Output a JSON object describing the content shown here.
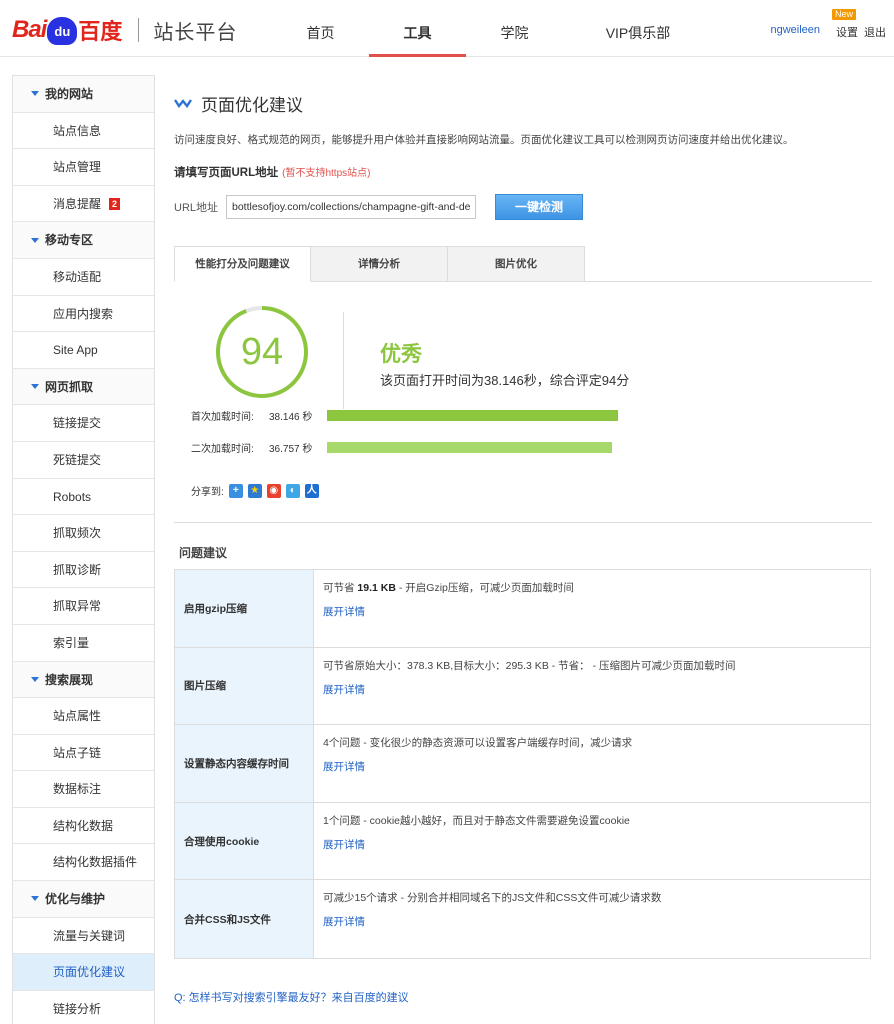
{
  "header": {
    "logo_bai": "Bai",
    "logo_paw": "du",
    "logo_du": "百度",
    "subtitle": "站长平台",
    "nav": [
      "首页",
      "工具",
      "学院",
      "VIP俱乐部"
    ],
    "active_nav": "工具",
    "username": "ngweileen",
    "settings": "设置",
    "new_badge": "New",
    "logout": "退出"
  },
  "sidebar": [
    {
      "type": "group",
      "label": "我的网站"
    },
    {
      "type": "item",
      "label": "站点信息"
    },
    {
      "type": "item",
      "label": "站点管理"
    },
    {
      "type": "item",
      "label": "消息提醒",
      "badge": "2"
    },
    {
      "type": "group",
      "label": "移动专区"
    },
    {
      "type": "item",
      "label": "移动适配"
    },
    {
      "type": "item",
      "label": "应用内搜索"
    },
    {
      "type": "item",
      "label": "Site App"
    },
    {
      "type": "group",
      "label": "网页抓取"
    },
    {
      "type": "item",
      "label": "链接提交"
    },
    {
      "type": "item",
      "label": "死链提交"
    },
    {
      "type": "item",
      "label": "Robots"
    },
    {
      "type": "item",
      "label": "抓取频次"
    },
    {
      "type": "item",
      "label": "抓取诊断"
    },
    {
      "type": "item",
      "label": "抓取异常"
    },
    {
      "type": "item",
      "label": "索引量"
    },
    {
      "type": "group",
      "label": "搜索展现"
    },
    {
      "type": "item",
      "label": "站点属性"
    },
    {
      "type": "item",
      "label": "站点子链"
    },
    {
      "type": "item",
      "label": "数据标注"
    },
    {
      "type": "item",
      "label": "结构化数据"
    },
    {
      "type": "item",
      "label": "结构化数据插件"
    },
    {
      "type": "group",
      "label": "优化与维护"
    },
    {
      "type": "item",
      "label": "流量与关键词"
    },
    {
      "type": "item",
      "label": "页面优化建议",
      "active": true
    },
    {
      "type": "item",
      "label": "链接分析"
    }
  ],
  "main": {
    "title": "页面优化建议",
    "description": "访问速度良好、格式规范的网页，能够提升用户体验并直接影响网站流量。页面优化建议工具可以检测网页访问速度并给出优化建议。",
    "url_prompt": "请填写页面URL地址",
    "url_warning": "(暂不支持https站点)",
    "url_label": "URL地址",
    "url_value": "bottlesofjoy.com/collections/champagne-gift-and-delivery",
    "check_button": "一键检测",
    "tabs": [
      "性能打分及问题建议",
      "详情分析",
      "图片优化"
    ],
    "score": "94",
    "score_fraction": 0.94,
    "grade": "优秀",
    "grade_desc": "该页面打开时间为38.146秒，综合评定94分",
    "first_load_label": "首次加载时间:",
    "first_load_value": "38.146 秒",
    "second_load_label": "二次加载时间:",
    "second_load_value": "36.757 秒",
    "share_label": "分享到:",
    "colors": {
      "score": "#8cc63f",
      "bar1": "#8cc63f",
      "bar2": "#a6d96a",
      "link": "#2262c4",
      "warn": "#e0514c"
    },
    "issues_title": "问题建议",
    "issues": [
      {
        "name": "启用gzip压缩",
        "pre": "可节省 ",
        "bold": "19.1 KB",
        "post": " - 开启Gzip压缩，可减少页面加载时间",
        "expand": "展开详情"
      },
      {
        "name": "图片压缩",
        "pre": "可节省原始大小：378.3 KB,目标大小：295.3 KB - 节省：  - 压缩图片可减少页面加载时间",
        "bold": "",
        "post": "",
        "expand": "展开详情"
      },
      {
        "name": "设置静态内容缓存时间",
        "pre": "4个问题 - 变化很少的静态资源可以设置客户端缓存时间，减少请求",
        "bold": "",
        "post": "",
        "expand": "展开详情"
      },
      {
        "name": "合理使用cookie",
        "pre": "1个问题 - cookie越小越好，而且对于静态文件需要避免设置cookie",
        "bold": "",
        "post": "",
        "expand": "展开详情"
      },
      {
        "name": "合并CSS和JS文件",
        "pre": "可减少15个请求 - 分别合并相同域名下的JS文件和CSS文件可减少请求数",
        "bold": "",
        "post": "",
        "expand": "展开详情"
      }
    ],
    "faq": "Q: 怎样书写对搜索引擎最友好？来自百度的建议"
  }
}
